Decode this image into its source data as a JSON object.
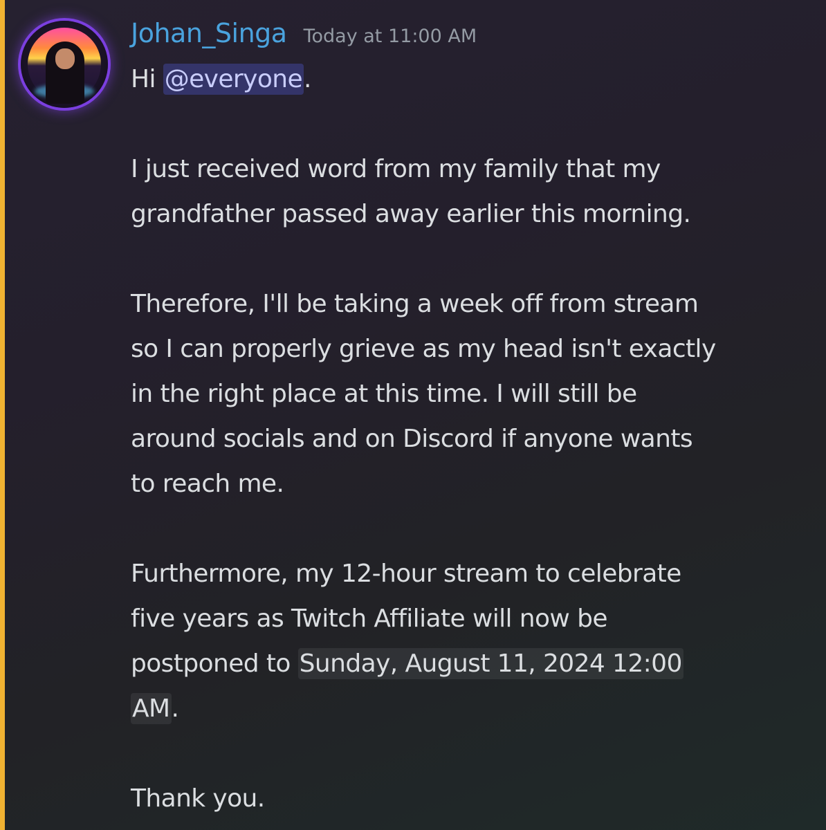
{
  "message": {
    "author": "Johan_Singa",
    "timestamp": "Today at 11:00 AM",
    "greeting_prefix": "Hi ",
    "mention": "@everyone",
    "greeting_suffix": ".",
    "paragraph_1_line_1": "I just received word from my family that my",
    "paragraph_1_line_2": "grandfather passed away earlier this morning.",
    "paragraph_2_line_1": "Therefore, I'll be taking a week off from stream",
    "paragraph_2_line_2": "so I can properly grieve as my head isn't exactly",
    "paragraph_2_line_3": "in the right place at this time. I will still be",
    "paragraph_2_line_4": "around socials and on Discord if anyone wants",
    "paragraph_2_line_5": "to reach me.",
    "paragraph_3_line_1": "Furthermore, my 12-hour stream to celebrate",
    "paragraph_3_line_2": "five years as Twitch Affiliate will now be",
    "paragraph_3_prefix": "postponed to ",
    "date_chip_part_1": "Sunday, August 11, 2024 12:00",
    "date_chip_part_2": "AM",
    "paragraph_3_suffix": ".",
    "closing": "Thank you."
  },
  "colors": {
    "username": "#4aa3de",
    "mention_highlight_bar": "#f0b232",
    "mention_bg": "#5865f2",
    "body_text": "#dbdee1",
    "timestamp": "#949ba4"
  },
  "icons": {
    "avatar": "user-avatar-icon"
  }
}
